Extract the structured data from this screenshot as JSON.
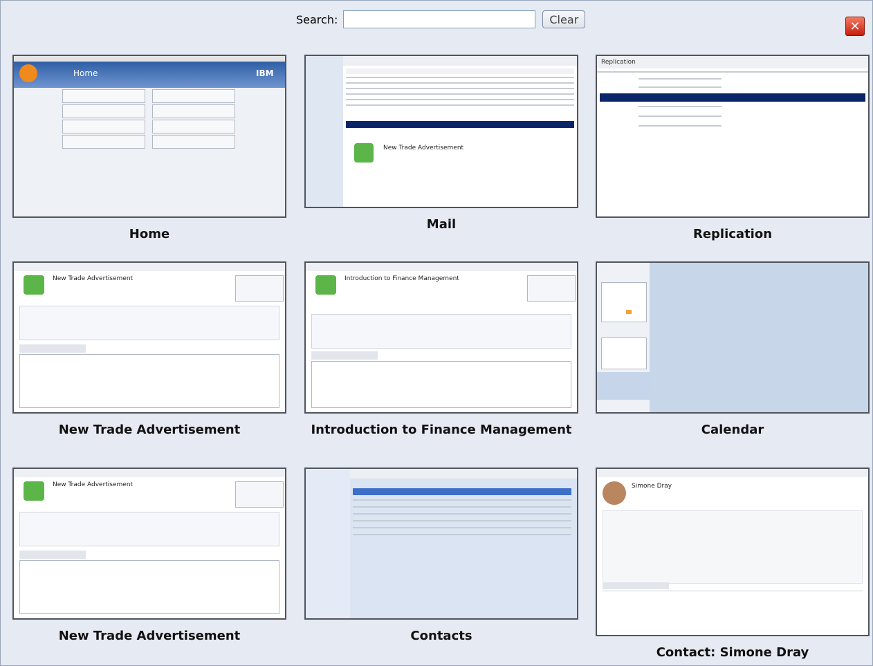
{
  "search": {
    "label": "Search:",
    "value": "",
    "placeholder": ""
  },
  "clear_label": "Clear",
  "close_glyph": "✕",
  "tiles": [
    {
      "caption": "Home"
    },
    {
      "caption": "Mail"
    },
    {
      "caption": "Replication"
    },
    {
      "caption": "New Trade Advertisement"
    },
    {
      "caption": "Introduction to Finance Management"
    },
    {
      "caption": "Calendar"
    },
    {
      "caption": "New Trade Advertisement"
    },
    {
      "caption": "Contacts"
    },
    {
      "caption": "Contact: Simone Dray"
    }
  ],
  "thumb_text": {
    "home_app": "Home",
    "home_brand": "IBM",
    "mail_heading": "New Trade Advertisement",
    "replication_heading": "Replication",
    "trade_heading": "New Trade Advertisement",
    "finance_heading": "Introduction to Finance Management",
    "contact_name": "Simone Dray"
  },
  "colors": {
    "accent": "#0a246a",
    "window_bg": "#e6eaf2",
    "close_red": "#d22a14",
    "home_blue": "#3f6fb2"
  }
}
